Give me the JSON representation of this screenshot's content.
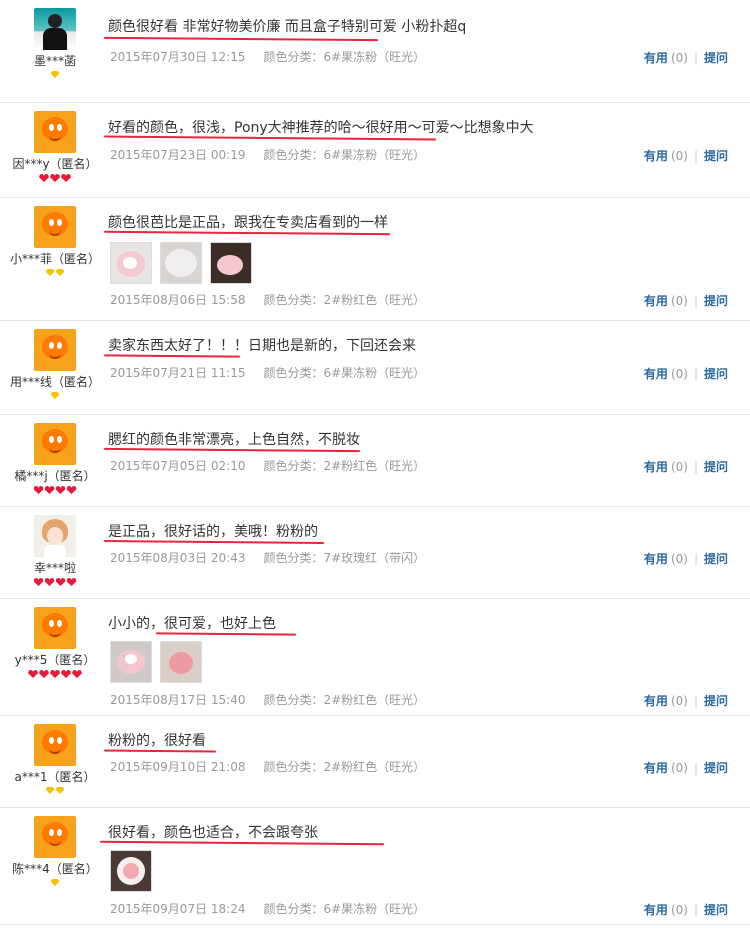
{
  "reviews": [
    {
      "text": "颜色很好看 非常好物美价廉 而且盒子特别可爱 小粉扑超q",
      "date": "2015年07月30日 12:15",
      "sku": "颜色分类：6#果冻粉（旺光）",
      "user": "墨***菡",
      "useful": "有用",
      "count": "(0)",
      "ask": "提问"
    },
    {
      "text": "好看的颜色，很浅，Pony大神推荐的哈～很好用～可爱～比想象中大",
      "date": "2015年07月23日 00:19",
      "sku": "颜色分类：6#果冻粉（旺光）",
      "user": "因***y（匿名）",
      "useful": "有用",
      "count": "(0)",
      "ask": "提问"
    },
    {
      "text": "颜色很芭比是正品，跟我在专卖店看到的一样",
      "date": "2015年08月06日 15:58",
      "sku": "颜色分类：2#粉红色（旺光）",
      "user": "小***菲（匿名）",
      "useful": "有用",
      "count": "(0)",
      "ask": "提问"
    },
    {
      "text": "卖家东西太好了！！！日期也是新的，下回还会来",
      "date": "2015年07月21日 11:15",
      "sku": "颜色分类：6#果冻粉（旺光）",
      "user": "用***线（匿名）",
      "useful": "有用",
      "count": "(0)",
      "ask": "提问"
    },
    {
      "text": "腮红的颜色非常漂亮，上色自然，不脱妆",
      "date": "2015年07月05日 02:10",
      "sku": "颜色分类：2#粉红色（旺光）",
      "user": "橘***j（匿名）",
      "useful": "有用",
      "count": "(0)",
      "ask": "提问"
    },
    {
      "text": "是正品，很好话的，美哦！粉粉的",
      "date": "2015年08月03日 20:43",
      "sku": "颜色分类：7#玫瑰红（带闪）",
      "user": "幸***啦",
      "useful": "有用",
      "count": "(0)",
      "ask": "提问"
    },
    {
      "text": "小小的，很可爱，也好上色",
      "date": "2015年08月17日 15:40",
      "sku": "颜色分类：2#粉红色（旺光）",
      "user": "y***5（匿名）",
      "useful": "有用",
      "count": "(0)",
      "ask": "提问"
    },
    {
      "text": "粉粉的，很好看",
      "date": "2015年09月10日 21:08",
      "sku": "颜色分类：2#粉红色（旺光）",
      "user": "a***1（匿名）",
      "useful": "有用",
      "count": "(0)",
      "ask": "提问"
    },
    {
      "text": "很好看，颜色也适合，不会跟夸张",
      "date": "2015年09月07日 18:24",
      "sku": "颜色分类：6#果冻粉（旺光）",
      "user": "陈***4（匿名）",
      "useful": "有用",
      "count": "(0)",
      "ask": "提问"
    }
  ],
  "colors": {
    "link": "#2c6aa0",
    "meta": "#999999",
    "underline": "#e8253a"
  }
}
